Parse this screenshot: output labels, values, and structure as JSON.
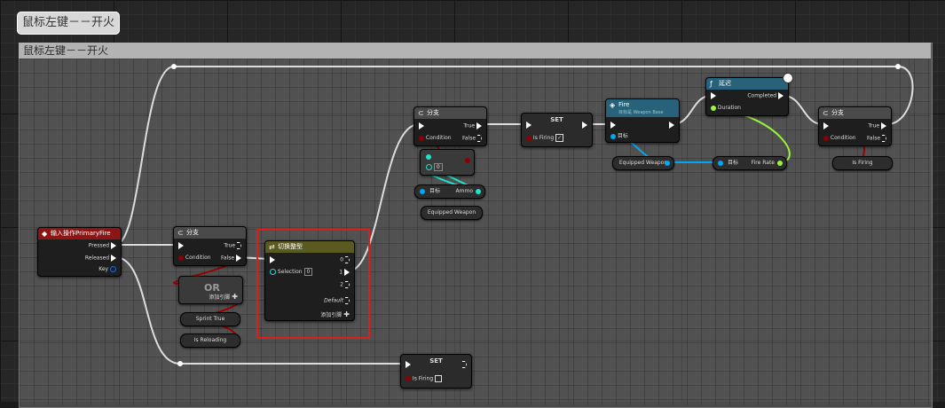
{
  "tab_title": "鼠标左键－－开火",
  "comment_title": "鼠标左键－－开火",
  "nodes": {
    "input_event": {
      "title": "输入操作PrimaryFire",
      "pins": {
        "pressed": "Pressed",
        "released": "Released",
        "key": "Key"
      }
    },
    "branch1": {
      "title": "分支",
      "pins": {
        "true": "True",
        "condition": "Condition",
        "false": "False"
      }
    },
    "or": {
      "title": "OR",
      "add_pin": "添加引脚"
    },
    "sprint_var": {
      "label": "Sprint True"
    },
    "reloading_var": {
      "label": "Is Reloading"
    },
    "switch": {
      "title": "切换整型",
      "pins": {
        "selection": "Selection",
        "selection_value": "0",
        "out0": "0",
        "out1": "1",
        "out2": "2",
        "default": "Default"
      },
      "add_pin": "添加引脚"
    },
    "set_bottom": {
      "title": "SET",
      "pin": "Is Firing"
    },
    "branch2": {
      "title": "分支",
      "pins": {
        "true": "True",
        "condition": "Condition",
        "false": "False"
      }
    },
    "compare": {
      "value": "0"
    },
    "ammo": {
      "target": "目标",
      "label": "Ammo"
    },
    "equipped1": {
      "label": "Equipped Weapon"
    },
    "set_top": {
      "title": "SET",
      "pin": "Is Firing"
    },
    "fire": {
      "title": "Fire",
      "subtitle": "目标是 Weapon Base",
      "target": "目标"
    },
    "equipped2": {
      "label": "Equipped Weapon"
    },
    "delay": {
      "title": "延迟",
      "pins": {
        "completed": "Completed",
        "duration": "Duration"
      }
    },
    "firerate": {
      "target": "目标",
      "label": "Fire Rate"
    },
    "branch3": {
      "title": "分支",
      "pins": {
        "true": "True",
        "condition": "Condition",
        "false": "False"
      }
    },
    "isfiring_var": {
      "label": "Is Firing"
    }
  },
  "colors": {
    "exec": "#ffffff",
    "bool": "#8c0000",
    "int": "#1ee3cf",
    "object": "#00a8f4",
    "float": "#9cf23c",
    "highlight": "#e01b1b"
  }
}
